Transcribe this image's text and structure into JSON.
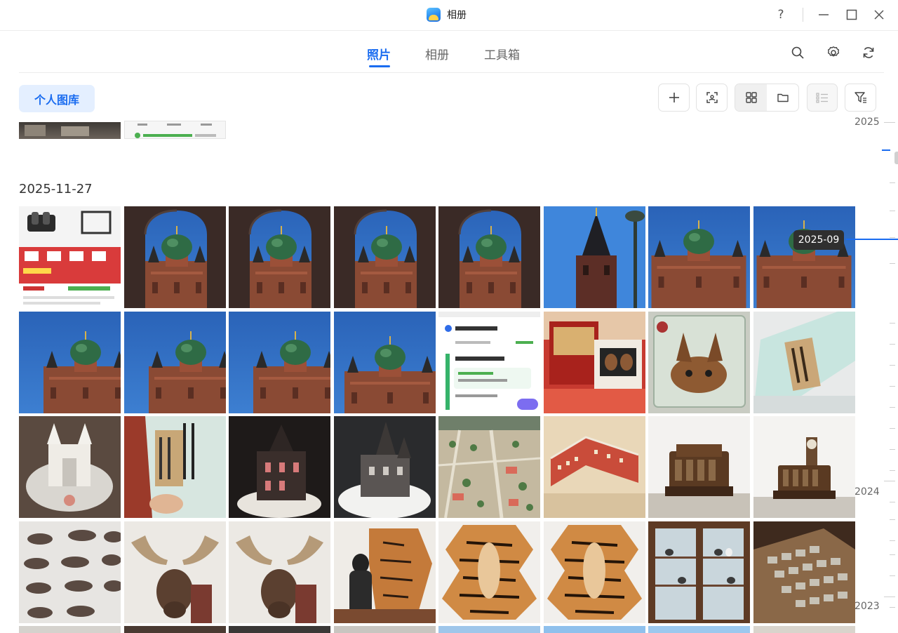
{
  "window": {
    "title": "相册",
    "controls": {
      "help": "?",
      "minimize": "—",
      "maximize": "☐",
      "close": "✕"
    }
  },
  "tabs": [
    {
      "label": "照片",
      "active": true
    },
    {
      "label": "相册",
      "active": false
    },
    {
      "label": "工具箱",
      "active": false
    }
  ],
  "header_icons": [
    "search-icon",
    "settings-icon",
    "refresh-icon"
  ],
  "toolbar": {
    "library_label": "个人图库",
    "buttons": [
      "add-icon",
      "face-scan-icon",
      "grid-view-icon",
      "folder-view-icon",
      "list-view-icon",
      "filter-icon"
    ],
    "view_mode": "grid"
  },
  "content": {
    "section_date": "2025-11-27",
    "rows": 4,
    "columns": 8,
    "photos": [
      "product-listing",
      "cathedral-arch",
      "cathedral-arch",
      "cathedral-arch",
      "cathedral-arch",
      "dark-spire",
      "cathedral-front",
      "cathedral-front",
      "cathedral-domes",
      "cathedral-domes",
      "cathedral-domes",
      "cathedral-side",
      "map-route",
      "souvenir-box",
      "specimen-jar",
      "glass-plaque",
      "church-model-glass",
      "glass-plaque-hand",
      "church-model-dark",
      "church-model-white",
      "city-model",
      "building-model",
      "cash-register",
      "cash-register-clock",
      "wall-skulls",
      "moose-head",
      "moose-head",
      "tiger-skin-person",
      "tiger-skin",
      "tiger-skin",
      "display-cabinet",
      "specimen-drawers"
    ]
  },
  "timeline": {
    "years": [
      "2025",
      "2024",
      "2023"
    ],
    "current": "2025-09"
  },
  "colors": {
    "accent": "#1a6cf0",
    "tooltip_bg": "#2f2f2f"
  }
}
